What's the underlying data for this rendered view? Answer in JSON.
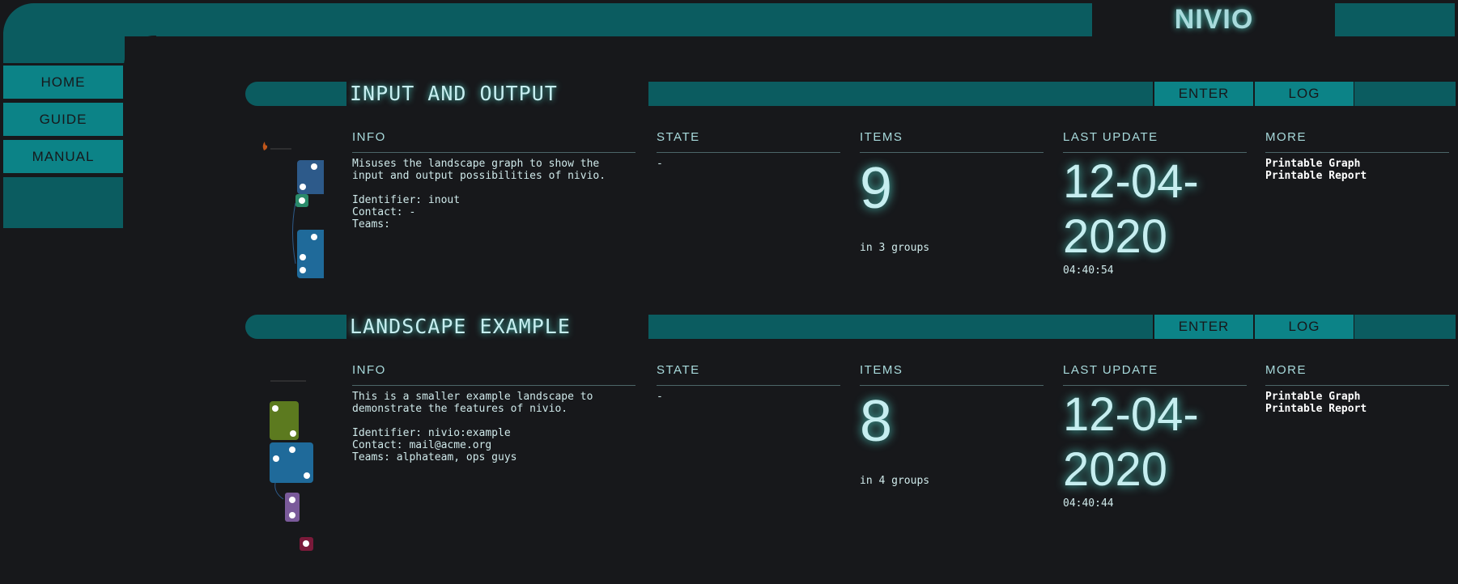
{
  "app": {
    "title": "NIVIO"
  },
  "nav": {
    "home": "HOME",
    "guide": "GUIDE",
    "manual": "MANUAL"
  },
  "labels": {
    "enter": "ENTER",
    "log": "LOG",
    "info": "INFO",
    "state": "STATE",
    "items": "ITEMS",
    "last_update": "LAST UPDATE",
    "more": "MORE",
    "printable_graph": "Printable Graph",
    "printable_report": "Printable Report"
  },
  "landscapes": [
    {
      "title": "INPUT AND OUTPUT",
      "description_line1": "Misuses the landscape graph to show the",
      "description_line2": "input and output possibilities of nivio.",
      "identifier": "Identifier: inout",
      "contact": "Contact: -",
      "teams": "Teams:",
      "state": "-",
      "items": "9",
      "groups": "in 3 groups",
      "date_line1": "12-04-",
      "date_line2": "2020",
      "time": "04:40:54"
    },
    {
      "title": "LANDSCAPE EXAMPLE",
      "description_line1": "This is a smaller example landscape to",
      "description_line2": "demonstrate the features of nivio.",
      "identifier": "Identifier: nivio:example",
      "contact": "Contact: mail@acme.org",
      "teams": "Teams: alphateam, ops guys",
      "state": "-",
      "items": "8",
      "groups": "in 4 groups",
      "date_line1": "12-04-",
      "date_line2": "2020",
      "time": "04:40:44"
    }
  ],
  "colors": {
    "frame": "#0b5c60",
    "button": "#0c8387",
    "background": "#17181b",
    "text": "#a8dadc"
  }
}
